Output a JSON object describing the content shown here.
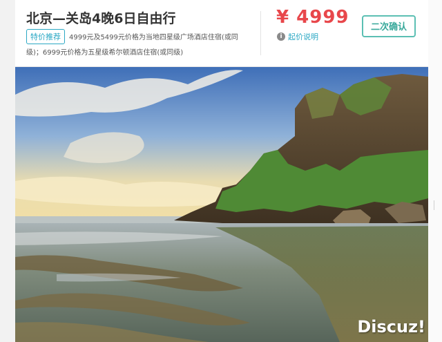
{
  "product": {
    "title": "北京—关岛4晚6日自由行",
    "badge": "特价推荐",
    "description": "4999元及5499元价格为当地四星级广场酒店住宿(或同级)；6999元价格为五星级希尔顿酒店住宿(或同级)",
    "price": "¥ 4999",
    "price_note": "起价说明",
    "confirm_label": "二次确认"
  },
  "watermark": "Discuz!",
  "colors": {
    "price": "#e8474b",
    "accent": "#2aa8c4",
    "confirm_border": "#5bbfb3"
  }
}
